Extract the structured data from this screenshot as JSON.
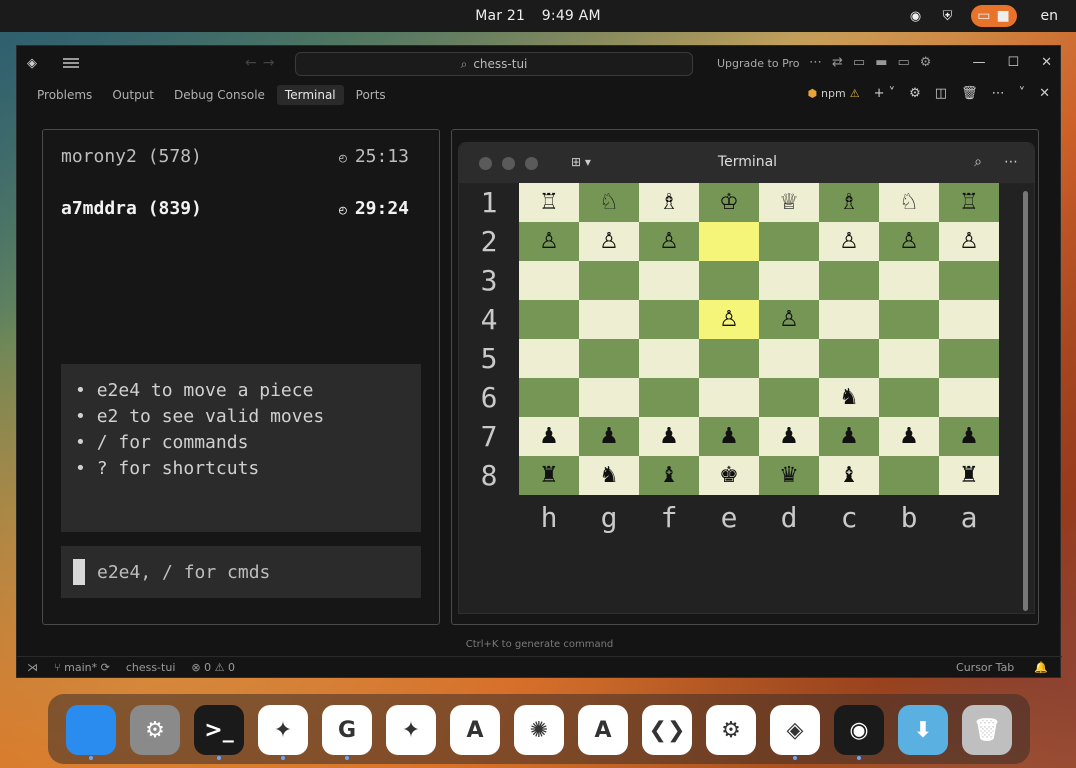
{
  "topbar": {
    "date": "Mar 21",
    "time": "9:49 AM",
    "language": "en"
  },
  "titlebar": {
    "search_text": "chess-tui",
    "upgrade_label": "Upgrade to Pro"
  },
  "panel": {
    "tabs": [
      {
        "label": "Problems"
      },
      {
        "label": "Output"
      },
      {
        "label": "Debug Console"
      },
      {
        "label": "Terminal",
        "active": true
      },
      {
        "label": "Ports"
      }
    ],
    "npm_label": "npm"
  },
  "game": {
    "player1": {
      "name": "morony2 (578)",
      "time": "25:13"
    },
    "player2": {
      "name": "a7mddra (839)",
      "time": "29:24"
    },
    "help": [
      "e2e4 to move a piece",
      "e2 to see valid moves",
      "/ for commands",
      "? for shortcuts"
    ],
    "input_placeholder": "e2e4, / for cmds"
  },
  "terminal": {
    "title": "Terminal",
    "ranks": [
      "1",
      "2",
      "3",
      "4",
      "5",
      "6",
      "7",
      "8"
    ],
    "files": [
      "h",
      "g",
      "f",
      "e",
      "d",
      "c",
      "b",
      "a"
    ],
    "board": [
      [
        "wR",
        "wN",
        "wB",
        "wK",
        "wQ",
        "wB",
        "wN",
        "wR"
      ],
      [
        "wP",
        "wP",
        "wP",
        "",
        "",
        "wP",
        "wP",
        "wP"
      ],
      [
        "",
        "",
        "",
        "",
        "",
        "",
        "",
        ""
      ],
      [
        "",
        "",
        "",
        "wP",
        "wP",
        "",
        "",
        ""
      ],
      [
        "",
        "",
        "",
        "",
        "",
        "",
        "",
        ""
      ],
      [
        "",
        "",
        "",
        "",
        "",
        "bN",
        "",
        ""
      ],
      [
        "bP",
        "bP",
        "bP",
        "bP",
        "bP",
        "bP",
        "bP",
        "bP"
      ],
      [
        "bR",
        "bN",
        "bB",
        "bK",
        "bQ",
        "bB",
        "",
        "bR"
      ]
    ],
    "highlight": [
      "1-3",
      "3-3"
    ],
    "colors": {
      "light": "#eeeed2",
      "dark": "#769656",
      "highlight": "#f5f57a"
    }
  },
  "footer": {
    "hint": "Ctrl+K to generate command",
    "branch": "main*",
    "project": "chess-tui",
    "errors": "0",
    "warnings": "0",
    "cursor_tab": "Cursor Tab"
  },
  "dock": {
    "apps": [
      {
        "name": "finder",
        "label": "",
        "bg": "#2b8cf0",
        "dot": true
      },
      {
        "name": "settings",
        "label": "⚙",
        "bg": "#8a8a8a",
        "dot": false
      },
      {
        "name": "terminal",
        "label": ">_",
        "bg": "#1a1a1a",
        "dot": true
      },
      {
        "name": "figma",
        "label": "✦",
        "bg": "#ffffff",
        "dot": true
      },
      {
        "name": "google",
        "label": "G",
        "bg": "#ffffff",
        "dot": true
      },
      {
        "name": "gemini",
        "label": "✦",
        "bg": "#ffffff",
        "dot": false
      },
      {
        "name": "anthropic-a",
        "label": "A",
        "bg": "#ffffff",
        "dot": false
      },
      {
        "name": "claude",
        "label": "✺",
        "bg": "#ffffff",
        "dot": false
      },
      {
        "name": "android-studio",
        "label": "A",
        "bg": "#ffffff",
        "dot": false
      },
      {
        "name": "vscode",
        "label": "❮❯",
        "bg": "#ffffff",
        "dot": false
      },
      {
        "name": "chatgpt",
        "label": "⚙",
        "bg": "#ffffff",
        "dot": false
      },
      {
        "name": "cursor",
        "label": "◈",
        "bg": "#ffffff",
        "dot": true
      },
      {
        "name": "obs",
        "label": "◉",
        "bg": "#1a1a1a",
        "dot": true
      },
      {
        "name": "downloads",
        "label": "⬇",
        "bg": "#5ab0e0",
        "dot": false
      },
      {
        "name": "trash",
        "label": "🗑",
        "bg": "#bfbfbf",
        "dot": false
      }
    ]
  }
}
